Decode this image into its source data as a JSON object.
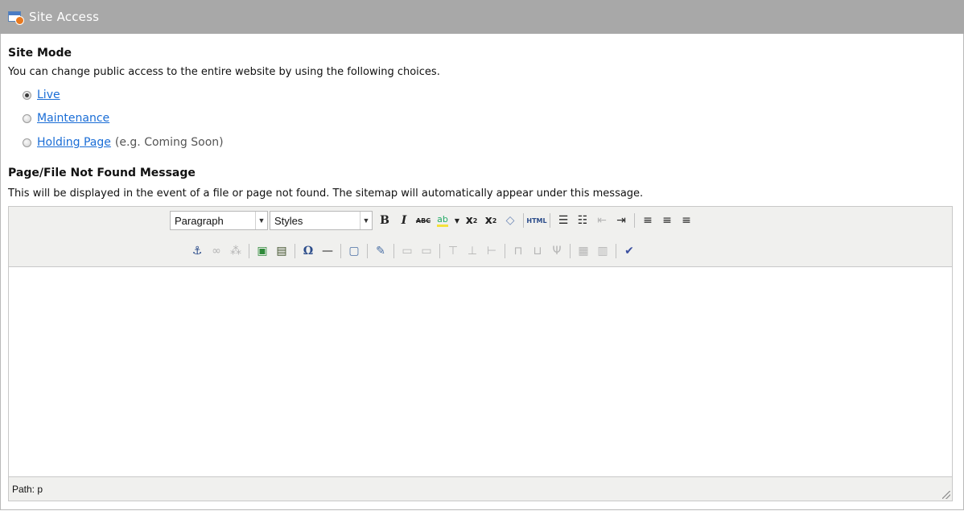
{
  "panel": {
    "title": "Site Access"
  },
  "site_mode": {
    "heading": "Site Mode",
    "description": "You can change public access to the entire website by using the following choices.",
    "options": [
      {
        "label": "Live",
        "checked": true,
        "note": ""
      },
      {
        "label": "Maintenance",
        "checked": false,
        "note": ""
      },
      {
        "label": "Holding Page",
        "checked": false,
        "note": "(e.g. Coming Soon)"
      }
    ]
  },
  "not_found": {
    "heading": "Page/File Not Found Message",
    "description": "This will be displayed in the event of a file or page not found. The sitemap will automatically appear under this message."
  },
  "editor": {
    "format_select": "Paragraph",
    "styles_select": "Styles",
    "status_path": "Path: p",
    "toolbar_row1": [
      "bold-icon",
      "italic-icon",
      "strikethrough-icon",
      "highlight-color-icon",
      "subscript-icon",
      "superscript-icon",
      "clear-format-icon",
      "html-source-icon",
      "bullet-list-icon",
      "numbered-list-icon",
      "outdent-icon",
      "indent-icon",
      "align-left-icon",
      "align-center-icon",
      "align-right-icon"
    ],
    "toolbar_row2": [
      "anchor-icon",
      "link-icon",
      "unlink-icon",
      "image-icon",
      "media-icon",
      "special-char-icon",
      "horizontal-rule-icon",
      "template-icon",
      "edit-icon",
      "table-props-icon",
      "cell-props-icon",
      "insert-row-icon",
      "delete-row-icon",
      "insert-col-icon",
      "merge-cells-icon",
      "split-cells-icon",
      "delete-col-icon",
      "table-icon",
      "table-del-icon",
      "spellcheck-icon"
    ],
    "html_label": "HTML",
    "abc_label": "ABC"
  }
}
